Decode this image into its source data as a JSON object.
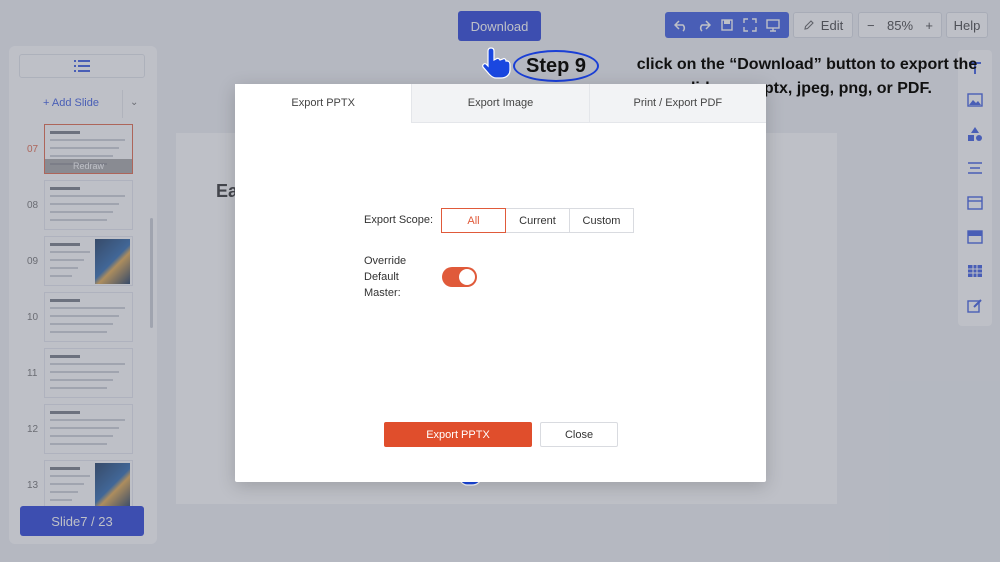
{
  "toolbar": {
    "download_label": "Download",
    "edit_label": "Edit",
    "zoom_out": "−",
    "zoom_level": "85%",
    "zoom_in": "+",
    "help_label": "Help",
    "tool_icons": [
      "undo-icon",
      "redo-icon",
      "save-icon",
      "fullscreen-icon",
      "present-icon"
    ]
  },
  "sidebar": {
    "add_slide_label": "+ Add Slide",
    "slides": [
      {
        "number": "07",
        "active": true,
        "has_image": false,
        "overlay_label": "Redraw"
      },
      {
        "number": "08",
        "active": false,
        "has_image": false
      },
      {
        "number": "09",
        "active": false,
        "has_image": true
      },
      {
        "number": "10",
        "active": false,
        "has_image": false
      },
      {
        "number": "11",
        "active": false,
        "has_image": false
      },
      {
        "number": "12",
        "active": false,
        "has_image": false
      },
      {
        "number": "13",
        "active": false,
        "has_image": true
      }
    ],
    "slide_counter": "Slide7 / 23"
  },
  "canvas": {
    "title_fragment": "Ea"
  },
  "right_rail": {
    "icons": [
      "text-icon",
      "image-icon",
      "shapes-icon",
      "align-icon",
      "layout-icon",
      "background-icon",
      "table-icon",
      "edit-note-icon"
    ]
  },
  "annotation": {
    "step_label": "Step 9",
    "instruction": "click on the “Download” button to export the slides as pptx, jpeg, png, or PDF."
  },
  "modal": {
    "tabs": [
      {
        "label": "Export PPTX",
        "active": true
      },
      {
        "label": "Export Image",
        "active": false
      },
      {
        "label": "Print / Export PDF",
        "active": false
      }
    ],
    "scope_label": "Export Scope:",
    "scope_options": [
      {
        "label": "All",
        "active": true
      },
      {
        "label": "Current",
        "active": false
      },
      {
        "label": "Custom",
        "active": false
      }
    ],
    "override_label": "Override Default Master:",
    "override_enabled": true,
    "export_button": "Export PPTX",
    "close_button": "Close"
  },
  "colors": {
    "accent_orange": "#e04e2c",
    "accent_blue": "#1530d6"
  }
}
